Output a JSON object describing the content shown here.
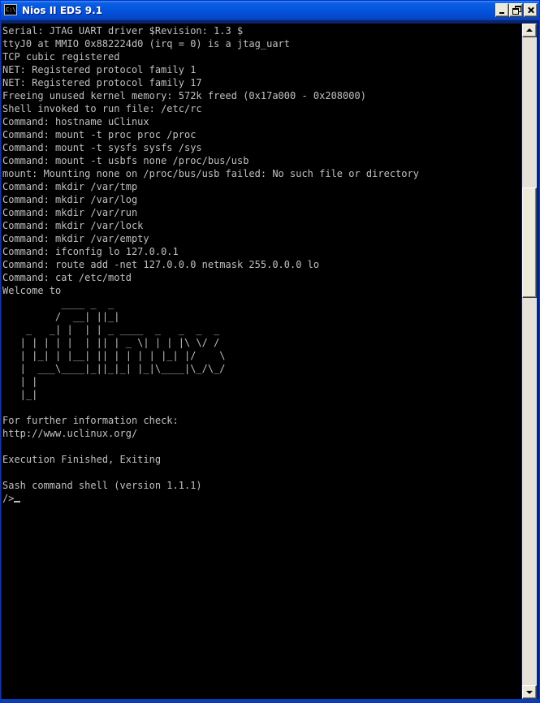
{
  "window": {
    "title": "Nios II EDS 9.1",
    "icon": "console-icon",
    "icon_glyph": "C:\\"
  },
  "console": {
    "lines": [
      "Serial: JTAG UART driver $Revision: 1.3 $",
      "ttyJ0 at MMIO 0x882224d0 (irq = 0) is a jtag_uart",
      "TCP cubic registered",
      "NET: Registered protocol family 1",
      "NET: Registered protocol family 17",
      "Freeing unused kernel memory: 572k freed (0x17a000 - 0x208000)",
      "Shell invoked to run file: /etc/rc",
      "Command: hostname uClinux",
      "Command: mount -t proc proc /proc",
      "Command: mount -t sysfs sysfs /sys",
      "Command: mount -t usbfs none /proc/bus/usb",
      "mount: Mounting none on /proc/bus/usb failed: No such file or directory",
      "Command: mkdir /var/tmp",
      "Command: mkdir /var/log",
      "Command: mkdir /var/run",
      "Command: mkdir /var/lock",
      "Command: mkdir /var/empty",
      "Command: ifconfig lo 127.0.0.1",
      "Command: route add -net 127.0.0.0 netmask 255.0.0.0 lo",
      "Command: cat /etc/motd",
      "Welcome to",
      "          ____ _  _",
      "         /  __| ||_|",
      "    _   _| |  | | _ ____  _   _  _  _",
      "   | | | | |  | || | _ \\| | | |\\ \\/ /",
      "   | |_| | |__| || | | | | |_| |/    \\",
      "   |  ___\\____|_||_|_| |_|\\____|\\_/\\_/",
      "   | |",
      "   |_|",
      "",
      "For further information check:",
      "http://www.uclinux.org/",
      "",
      "Execution Finished, Exiting",
      "",
      "Sash command shell (version 1.1.1)",
      "/>"
    ]
  },
  "scrollbar": {
    "position_fraction": 0.28,
    "visible_fraction": 0.17
  }
}
